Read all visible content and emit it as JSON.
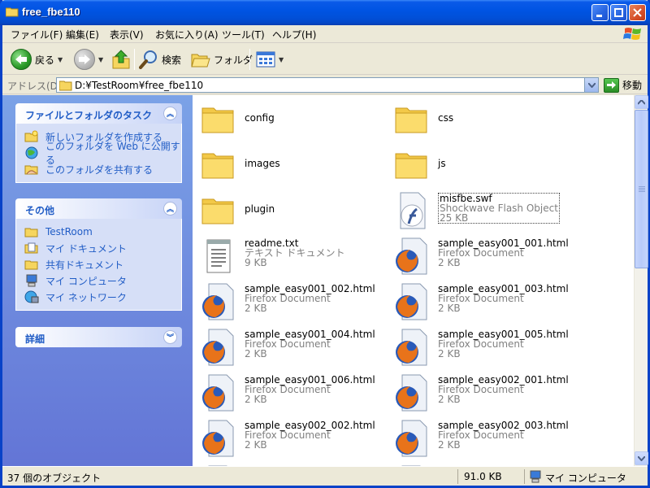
{
  "window": {
    "title": "free_fbe110"
  },
  "menu": [
    {
      "label": "ファイル(F)"
    },
    {
      "label": "編集(E)"
    },
    {
      "label": "表示(V)"
    },
    {
      "label": "お気に入り(A)"
    },
    {
      "label": "ツール(T)"
    },
    {
      "label": "ヘルプ(H)"
    }
  ],
  "toolbar": {
    "back_label": "戻る",
    "search_label": "検索",
    "folders_label": "フォルダ"
  },
  "address": {
    "label": "アドレス(D)",
    "path": "D:¥TestRoom¥free_fbe110",
    "go_label": "移動"
  },
  "tasks": {
    "title": "ファイルとフォルダのタスク",
    "items": [
      {
        "label": "新しいフォルダを作成する",
        "icon": "new-folder-icon"
      },
      {
        "label": "このフォルダを Web に公開する",
        "icon": "publish-web-icon"
      },
      {
        "label": "このフォルダを共有する",
        "icon": "share-folder-icon"
      }
    ]
  },
  "other": {
    "title": "その他",
    "items": [
      {
        "label": "TestRoom",
        "icon": "folder-icon"
      },
      {
        "label": "マイ ドキュメント",
        "icon": "my-documents-icon"
      },
      {
        "label": "共有ドキュメント",
        "icon": "shared-documents-icon"
      },
      {
        "label": "マイ コンピュータ",
        "icon": "my-computer-icon"
      },
      {
        "label": "マイ ネットワーク",
        "icon": "my-network-icon"
      }
    ]
  },
  "details": {
    "title": "詳細"
  },
  "files": [
    {
      "name": "config",
      "kind": "folder"
    },
    {
      "name": "css",
      "kind": "folder"
    },
    {
      "name": "images",
      "kind": "folder"
    },
    {
      "name": "js",
      "kind": "folder"
    },
    {
      "name": "plugin",
      "kind": "folder"
    },
    {
      "name": "misfbe.swf",
      "kind": "flash",
      "type": "Shockwave Flash Object",
      "size": "25 KB"
    },
    {
      "name": "readme.txt",
      "kind": "text",
      "type": "テキスト ドキュメント",
      "size": "9 KB"
    },
    {
      "name": "sample_easy001_001.html",
      "kind": "firefox",
      "type": "Firefox Document",
      "size": "2 KB"
    },
    {
      "name": "sample_easy001_002.html",
      "kind": "firefox",
      "type": "Firefox Document",
      "size": "2 KB"
    },
    {
      "name": "sample_easy001_003.html",
      "kind": "firefox",
      "type": "Firefox Document",
      "size": "2 KB"
    },
    {
      "name": "sample_easy001_004.html",
      "kind": "firefox",
      "type": "Firefox Document",
      "size": "2 KB"
    },
    {
      "name": "sample_easy001_005.html",
      "kind": "firefox",
      "type": "Firefox Document",
      "size": "2 KB"
    },
    {
      "name": "sample_easy001_006.html",
      "kind": "firefox",
      "type": "Firefox Document",
      "size": "2 KB"
    },
    {
      "name": "sample_easy002_001.html",
      "kind": "firefox",
      "type": "Firefox Document",
      "size": "2 KB"
    },
    {
      "name": "sample_easy002_002.html",
      "kind": "firefox",
      "type": "Firefox Document",
      "size": "2 KB"
    },
    {
      "name": "sample_easy002_003.html",
      "kind": "firefox",
      "type": "Firefox Document",
      "size": "2 KB"
    }
  ],
  "status": {
    "count": "37 個のオブジェクト",
    "size": "91.0 KB",
    "location": "マイ コンピュータ"
  },
  "colors": {
    "title_bar": "#0054e3",
    "task_pane_link": "#215dc6",
    "selection": "#316ac5"
  }
}
